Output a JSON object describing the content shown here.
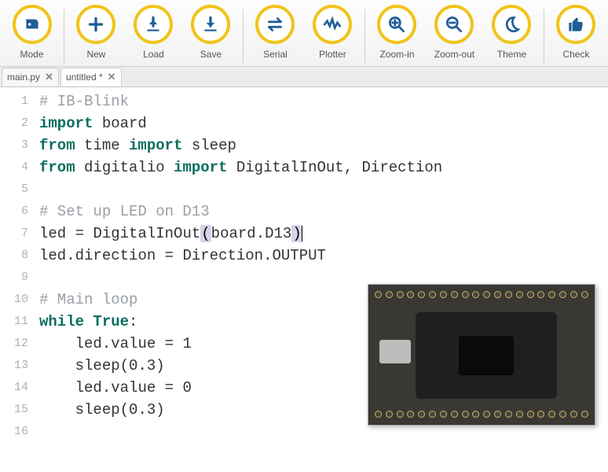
{
  "toolbar": {
    "buttons": [
      {
        "id": "mode",
        "label": "Mode",
        "icon": "robot-icon"
      },
      {
        "id": "new",
        "label": "New",
        "icon": "plus-icon"
      },
      {
        "id": "load",
        "label": "Load",
        "icon": "load-icon"
      },
      {
        "id": "save",
        "label": "Save",
        "icon": "save-icon"
      },
      {
        "id": "serial",
        "label": "Serial",
        "icon": "serial-icon"
      },
      {
        "id": "plotter",
        "label": "Plotter",
        "icon": "plotter-icon"
      },
      {
        "id": "zoomin",
        "label": "Zoom-in",
        "icon": "zoom-in-icon"
      },
      {
        "id": "zoomout",
        "label": "Zoom-out",
        "icon": "zoom-out-icon"
      },
      {
        "id": "theme",
        "label": "Theme",
        "icon": "moon-icon"
      },
      {
        "id": "check",
        "label": "Check",
        "icon": "thumbs-up-icon"
      }
    ],
    "separators_after": [
      0,
      3,
      5,
      8
    ]
  },
  "tabs": [
    {
      "label": "main.py",
      "dirty": false,
      "active": false
    },
    {
      "label": "untitled *",
      "dirty": true,
      "active": true
    }
  ],
  "code": {
    "lines": [
      "# IB-Blink",
      "import board",
      "from time import sleep",
      "from digitalio import DigitalInOut, Direction",
      "",
      "# Set up LED on D13",
      "led = DigitalInOut(board.D13)",
      "led.direction = Direction.OUTPUT",
      "",
      "# Main loop",
      "while True:",
      "    led.value = 1",
      "    sleep(0.3)",
      "    led.value = 0",
      "    sleep(0.3)",
      ""
    ],
    "cursor_line": 7,
    "syntax": {
      "keywords": [
        "import",
        "from",
        "while",
        "True"
      ],
      "comments_prefix": "#"
    }
  },
  "colors": {
    "accent_ring": "#f0c419",
    "icon": "#1f5d99",
    "keyword": "#0a6e5e",
    "comment": "#9aa0a6"
  },
  "overlay_image": {
    "description": "Adafruit ItsyBitsy microcontroller on breadboard"
  }
}
